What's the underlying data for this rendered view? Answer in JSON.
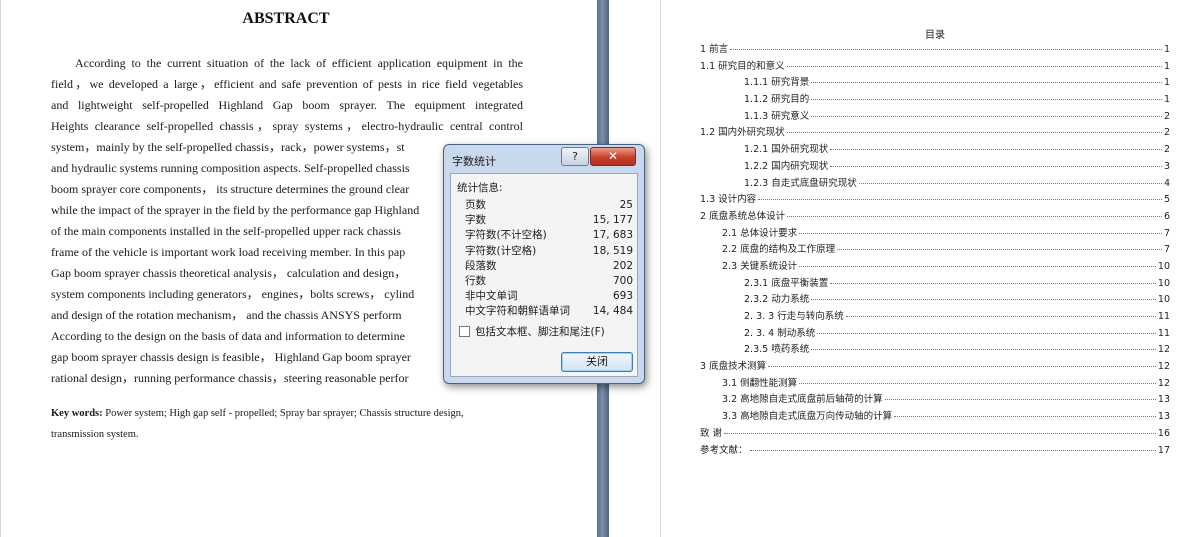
{
  "abstract": {
    "title": "ABSTRACT",
    "lines": [
      "According to the current situation of the lack of efficient application equipment in the",
      "field，we developed a large，efficient and safe prevention of pests in rice field vegetables",
      "and lightweight self-propelled Highland Gap boom sprayer. The equipment integrated",
      "Heights clearance self-propelled chassis，spray systems，electro-hydraulic central control",
      "system，mainly by the self-propelled chassis，rack，power systems，st",
      "and hydraulic systems running composition aspects. Self-propelled chassis",
      "boom sprayer core components， its structure determines the ground clear",
      "while the impact of the sprayer in the field by the performance gap Highland",
      "of the main components installed in the self-propelled upper rack chassis",
      "frame of the vehicle is important work load receiving member. In this pap",
      "Gap boom sprayer chassis theoretical analysis， calculation and design，",
      "system components including generators， engines，bolts screws， cylind",
      "and design of the rotation mechanism， and the chassis ANSYS perform",
      "According to the design on the basis of data and information to determine",
      "gap boom sprayer chassis design is feasible， Highland Gap boom sprayer",
      "rational design，running performance chassis，steering reasonable perfor"
    ],
    "keywords_label": "Key words:",
    "keywords_line1": " Power system;   High gap self - propelled;   Spray bar sprayer;   Chassis structure design,",
    "keywords_line2": "transmission system."
  },
  "toc": {
    "title": "目录",
    "entries": [
      {
        "level": 1,
        "label": "1 前言",
        "page": "1"
      },
      {
        "level": 2,
        "label": "1.1  研究目的和意义",
        "page": "1",
        "indent": 0
      },
      {
        "level": 3,
        "label": "1.1.1   研究背景",
        "page": "1"
      },
      {
        "level": 3,
        "label": "1.1.2  研究目的",
        "page": "1"
      },
      {
        "level": 3,
        "label": "1.1.3  研究意义",
        "page": "2"
      },
      {
        "level": 2,
        "label": "1.2  国内外研究现状",
        "page": "2",
        "indent": 0
      },
      {
        "level": 3,
        "label": "1.2.1  国外研究现状",
        "page": "2"
      },
      {
        "level": 3,
        "label": "1.2.2  国内研究现状",
        "page": "3"
      },
      {
        "level": 3,
        "label": "1.2.3  自走式底盘研究现状",
        "page": "4"
      },
      {
        "level": 2,
        "label": "1.3 设计内容",
        "page": "5",
        "indent": 0
      },
      {
        "level": 1,
        "label": "2 底盘系统总体设计",
        "page": "6"
      },
      {
        "level": 2,
        "label": "2.1   总体设计要求",
        "page": "7"
      },
      {
        "level": 2,
        "label": "2.2   底盘的结构及工作原理",
        "page": "7"
      },
      {
        "level": 2,
        "label": "2.3  关键系统设计",
        "page": "10"
      },
      {
        "level": 3,
        "label": "2.3.1  底盘平衡装置",
        "page": "10"
      },
      {
        "level": 3,
        "label": "2.3.2  动力系统",
        "page": "10"
      },
      {
        "level": 3,
        "label": "2. 3. 3  行走与转向系统",
        "page": "11"
      },
      {
        "level": 3,
        "label": "2. 3. 4 制动系统",
        "page": "11"
      },
      {
        "level": 3,
        "label": "2.3.5 喷药系统",
        "page": "12"
      },
      {
        "level": 1,
        "label": "3 底盘技术测算",
        "page": "12"
      },
      {
        "level": 2,
        "label": "3.1 侧翻性能测算",
        "page": "12"
      },
      {
        "level": 2,
        "label": "3.2 高地隙自走式底盘前后轴荷的计算",
        "page": "13"
      },
      {
        "level": 2,
        "label": "3.3 高地隙自走式底盘万向传动轴的计算",
        "page": "13"
      },
      {
        "level": 1,
        "label": "致    谢",
        "page": "16"
      },
      {
        "level": 1,
        "label": "参考文献：",
        "page": "17"
      }
    ]
  },
  "dialog": {
    "title": "字数统计",
    "help_label": "?",
    "close_label": "✕",
    "section_label": "统计信息:",
    "stats": [
      {
        "label": "页数",
        "value": "25"
      },
      {
        "label": "字数",
        "value": "15, 177"
      },
      {
        "label": "字符数(不计空格)",
        "value": "17, 683"
      },
      {
        "label": "字符数(计空格)",
        "value": "18, 519"
      },
      {
        "label": "段落数",
        "value": "202"
      },
      {
        "label": "行数",
        "value": "700"
      },
      {
        "label": "非中文单词",
        "value": "693"
      },
      {
        "label": "中文字符和朝鲜语单词",
        "value": "14, 484"
      }
    ],
    "checkbox_label": "包括文本框、脚注和尾注(F)",
    "checkbox_checked": false,
    "ok_label": "关闭"
  }
}
